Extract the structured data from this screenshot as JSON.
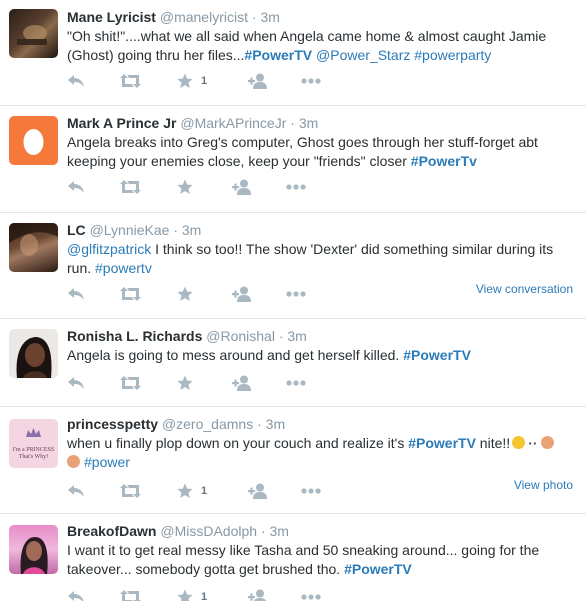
{
  "tweets": [
    {
      "name": "Mane Lyricist",
      "handle": "@manelyricist",
      "sep": "·",
      "time": "3m",
      "text_a": "\"Oh shit!\"....what we all said when Angela came home & almost caught Jamie (Ghost) going thru her files...",
      "tag_a": "#PowerTV",
      "link_a": "@Power_Starz",
      "tag_b": "#powerparty",
      "fav_count": "1"
    },
    {
      "name": "Mark A Prince Jr",
      "handle": "@MarkAPrinceJr",
      "sep": "·",
      "time": "3m",
      "text_a": "Angela breaks into Greg's computer, Ghost goes through her stuff-forget abt keeping your enemies close, keep your \"friends\" closer ",
      "tag_a": "#PowerTv"
    },
    {
      "name": "LC",
      "handle": "@LynnieKae",
      "sep": "·",
      "time": "3m",
      "link_a": "@glfitzpatrick",
      "text_a": " I think so too!! The show 'Dexter' did something similar during its run. ",
      "tag_a": "#powertv",
      "extra": "View conversation"
    },
    {
      "name": "Ronisha L. Richards",
      "handle": "@Ronishal",
      "sep": "·",
      "time": "3m",
      "text_a": "Angela is going to mess around and get herself killed. ",
      "tag_a": "#PowerTV"
    },
    {
      "name": "princesspetty",
      "handle": "@zero_damns",
      "sep": "·",
      "time": "3m",
      "text_a": "when u finally plop down on your couch and realize it's ",
      "tag_a": "#PowerTV",
      "text_b": " nite!!",
      "tag_b": "#power",
      "fav_count": "1",
      "extra": "View photo",
      "avatar_text": [
        "I'm a PRINCESS",
        "That's Why!"
      ]
    },
    {
      "name": "BreakofDawn",
      "handle": "@MissDAdolph",
      "sep": "·",
      "time": "3m",
      "text_a": "I want it to get real messy like Tasha and 50 sneaking around... going for the takeover... somebody gotta get brushed tho.  ",
      "tag_a": "#PowerTV",
      "fav_count": "1"
    }
  ],
  "colors": {
    "link": "#2b7bb9",
    "muted": "#8899a6",
    "icon": "#aab8c2",
    "egg_bg": "#f5793b",
    "divider": "#e1e8ed"
  },
  "icons": [
    "reply-icon",
    "retweet-icon",
    "favorite-star-icon",
    "follow-user-icon",
    "more-dots-icon",
    "egg-avatar-icon",
    "crown-icon"
  ]
}
